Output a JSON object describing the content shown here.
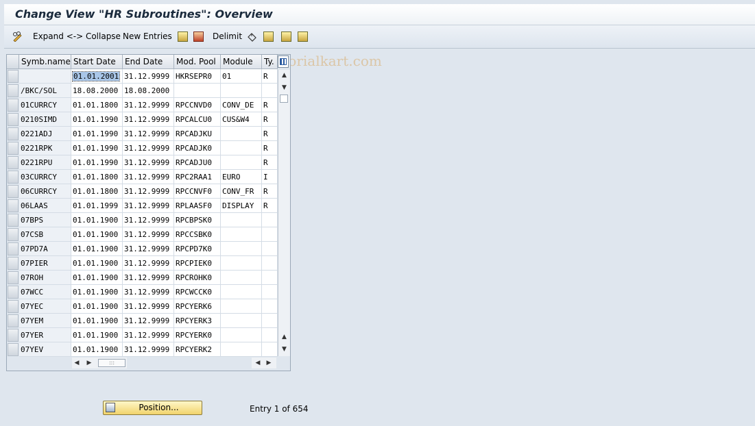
{
  "window": {
    "title": "Change View \"HR Subroutines\": Overview"
  },
  "toolbar": {
    "expand_collapse_label": "Expand <-> Collapse",
    "new_entries_label": "New Entries",
    "delimit_label": "Delimit",
    "watermark": "www.tutorialkart.com"
  },
  "table": {
    "columns": [
      "Symb.name",
      "Start Date",
      "End Date",
      "Mod. Pool",
      "Module",
      "Ty."
    ],
    "rows": [
      [
        "",
        "01.01.2001",
        "31.12.9999",
        "HKRSEPR0",
        "01",
        "R"
      ],
      [
        "/BKC/SOL",
        "18.08.2000",
        "18.08.2000",
        "",
        "",
        ""
      ],
      [
        "01CURRCY",
        "01.01.1800",
        "31.12.9999",
        "RPCCNVD0",
        "CONV_DE",
        "R"
      ],
      [
        "0210SIMD",
        "01.01.1990",
        "31.12.9999",
        "RPCALCU0",
        "CUS&W4",
        "R"
      ],
      [
        "0221ADJ",
        "01.01.1990",
        "31.12.9999",
        "RPCADJKU",
        "",
        "R"
      ],
      [
        "0221RPK",
        "01.01.1990",
        "31.12.9999",
        "RPCADJK0",
        "",
        "R"
      ],
      [
        "0221RPU",
        "01.01.1990",
        "31.12.9999",
        "RPCADJU0",
        "",
        "R"
      ],
      [
        "03CURRCY",
        "01.01.1800",
        "31.12.9999",
        "RPC2RAA1",
        "EURO",
        "I"
      ],
      [
        "06CURRCY",
        "01.01.1800",
        "31.12.9999",
        "RPCCNVF0",
        "CONV_FR",
        "R"
      ],
      [
        "06LAAS",
        "01.01.1999",
        "31.12.9999",
        "RPLAASF0",
        "DISPLAY",
        "R"
      ],
      [
        "07BPS",
        "01.01.1900",
        "31.12.9999",
        "RPCBPSK0",
        "",
        ""
      ],
      [
        "07CSB",
        "01.01.1900",
        "31.12.9999",
        "RPCCSBK0",
        "",
        ""
      ],
      [
        "07PD7A",
        "01.01.1900",
        "31.12.9999",
        "RPCPD7K0",
        "",
        ""
      ],
      [
        "07PIER",
        "01.01.1900",
        "31.12.9999",
        "RPCPIEK0",
        "",
        ""
      ],
      [
        "07ROH",
        "01.01.1900",
        "31.12.9999",
        "RPCROHK0",
        "",
        ""
      ],
      [
        "07WCC",
        "01.01.1900",
        "31.12.9999",
        "RPCWCCK0",
        "",
        ""
      ],
      [
        "07YEC",
        "01.01.1900",
        "31.12.9999",
        "RPCYERK6",
        "",
        ""
      ],
      [
        "07YEM",
        "01.01.1900",
        "31.12.9999",
        "RPCYERK3",
        "",
        ""
      ],
      [
        "07YER",
        "01.01.1900",
        "31.12.9999",
        "RPCYERK0",
        "",
        ""
      ],
      [
        "07YEV",
        "01.01.1900",
        "31.12.9999",
        "RPCYERK2",
        "",
        ""
      ]
    ]
  },
  "footer": {
    "position_label": "Position...",
    "entry_info": "Entry 1 of 654"
  },
  "icons": {
    "expand": "pencil-glasses-icon",
    "copy": "copy-icon",
    "save": "save-icon",
    "undo": "undo-icon",
    "select_all": "select-all-icon",
    "select_block": "select-block-icon",
    "deselect_all": "deselect-all-icon",
    "column_settings": "table-settings-icon"
  }
}
